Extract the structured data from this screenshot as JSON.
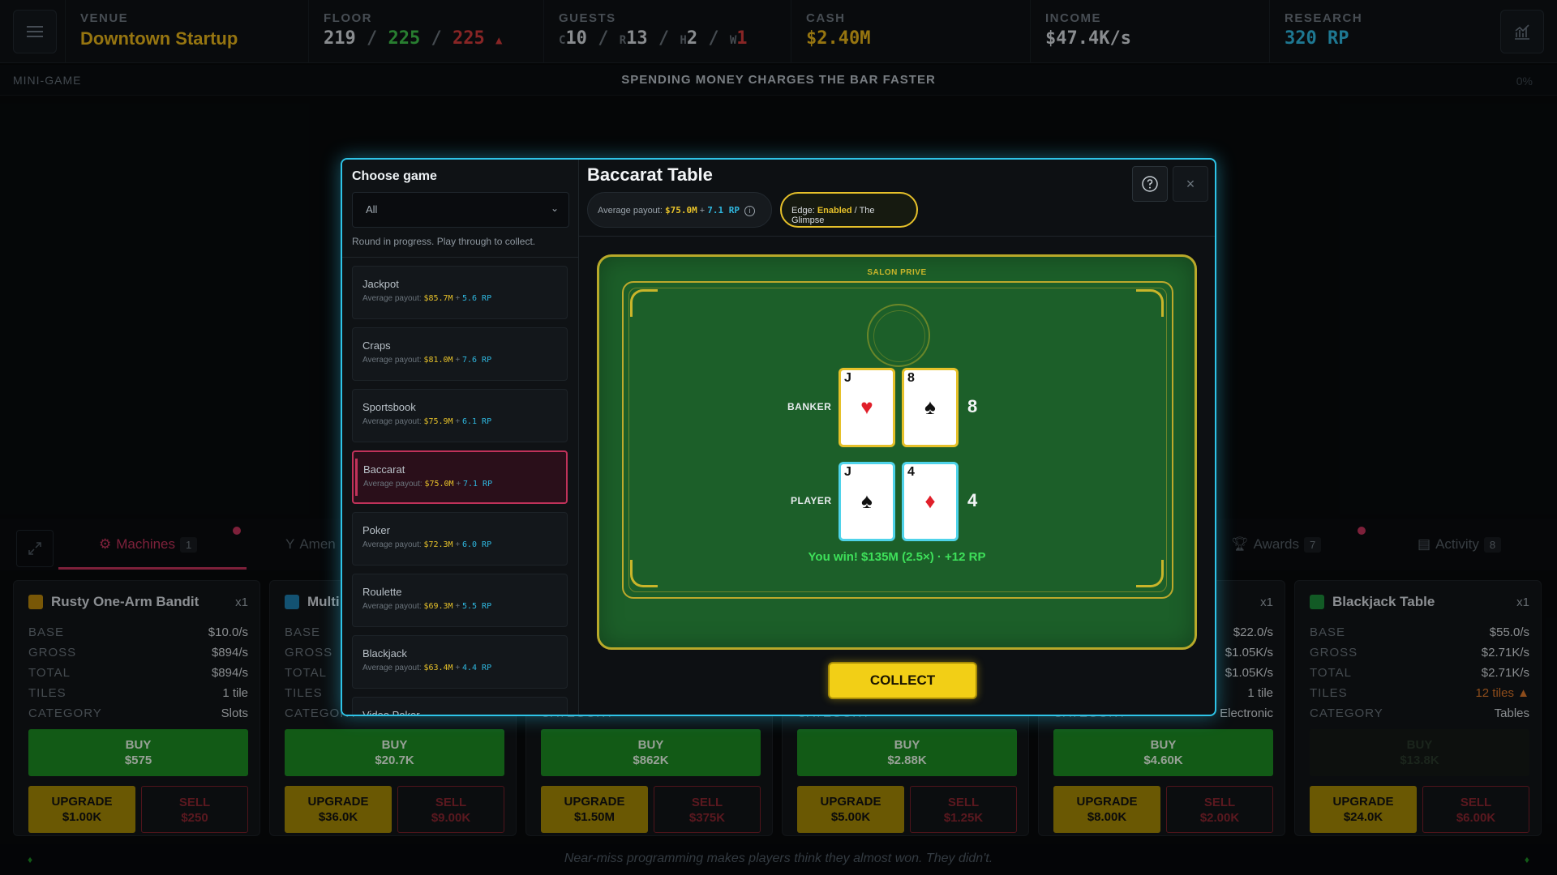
{
  "topbar": {
    "venue": {
      "label": "VENUE",
      "value": "Downtown Startup"
    },
    "floor": {
      "label": "FLOOR",
      "used": "219",
      "sep1": "/",
      "green": "225",
      "sep2": "/",
      "red": "225",
      "arrow": "▲"
    },
    "guests": {
      "label": "GUESTS",
      "c_lbl": "C",
      "c": "10",
      "r_lbl": "R",
      "r": "13",
      "h_lbl": "H",
      "h": "2",
      "w_lbl": "W",
      "w": "1",
      "sep": "/"
    },
    "cash": {
      "label": "CASH",
      "value": "$2.40M"
    },
    "income": {
      "label": "INCOME",
      "value": "$47.4K/s"
    },
    "research": {
      "label": "RESEARCH",
      "value": "320 RP"
    }
  },
  "subbar": {
    "label": "MINI-GAME",
    "message": "SPENDING MONEY CHARGES THE BAR FASTER",
    "percent": "0%"
  },
  "tabs": [
    {
      "label": "Machines",
      "count": "1"
    },
    {
      "label": "Amen",
      "count": ""
    },
    {
      "label": "Awards",
      "count": "7"
    },
    {
      "label": "Activity",
      "count": "8"
    }
  ],
  "cards": [
    {
      "title": "Rusty One-Arm Bandit",
      "qty": "x1",
      "color": "#b8860b",
      "base": "$10.0/s",
      "gross": "$894/s",
      "total": "$894/s",
      "tiles": "1 tile",
      "category": "Slots",
      "buy": "BUY",
      "buy_price": "$575",
      "upgrade": "UPGRADE",
      "upgrade_price": "$1.00K",
      "sell": "SELL",
      "sell_price": "$250"
    },
    {
      "title": "Multi",
      "qty": "",
      "color": "#1e7fb0",
      "base": "",
      "gross": "",
      "total": "",
      "tiles": "",
      "category": "",
      "buy": "BUY",
      "buy_price": "$20.7K",
      "upgrade": "UPGRADE",
      "upgrade_price": "$36.0K",
      "sell": "SELL",
      "sell_price": "$9.00K"
    },
    {
      "title": "",
      "qty": "",
      "color": "",
      "base": "",
      "gross": "",
      "total": "",
      "tiles": "",
      "category": "",
      "buy": "BUY",
      "buy_price": "$862K",
      "upgrade": "UPGRADE",
      "upgrade_price": "$1.50M",
      "sell": "SELL",
      "sell_price": "$375K"
    },
    {
      "title": "",
      "qty": "",
      "color": "",
      "base": "",
      "gross": "",
      "total": "",
      "tiles": "",
      "category": "",
      "buy": "BUY",
      "buy_price": "$2.88K",
      "upgrade": "UPGRADE",
      "upgrade_price": "$5.00K",
      "sell": "SELL",
      "sell_price": "$1.25K"
    },
    {
      "title": "",
      "qty": "x1",
      "color": "",
      "base": "$22.0/s",
      "gross": "$1.05K/s",
      "total": "$1.05K/s",
      "tiles": "1 tile",
      "category": "Electronic",
      "buy": "BUY",
      "buy_price": "$4.60K",
      "upgrade": "UPGRADE",
      "upgrade_price": "$8.00K",
      "sell": "SELL",
      "sell_price": "$2.00K"
    },
    {
      "title": "Blackjack Table",
      "qty": "x1",
      "color": "#1c8a3a",
      "base": "$55.0/s",
      "gross": "$2.71K/s",
      "total": "$2.71K/s",
      "tiles": "12 tiles ▲",
      "category": "Tables",
      "buy": "BUY",
      "buy_price": "$13.8K",
      "upgrade": "UPGRADE",
      "upgrade_price": "$24.0K",
      "sell": "SELL",
      "sell_price": "$6.00K"
    }
  ],
  "card_labels": {
    "base": "BASE",
    "gross": "GROSS",
    "total": "TOTAL",
    "tiles": "TILES",
    "category": "CATEGORY"
  },
  "footer": {
    "quote": "Near-miss programming makes players think they almost won. They didn't."
  },
  "modal": {
    "choose_title": "Choose game",
    "filter_value": "All",
    "progress_note": "Round in progress. Play through to collect.",
    "payout_prefix": "Average payout:",
    "games": [
      {
        "name": "Jackpot",
        "money": "$85.7M",
        "rp": "5.6 RP"
      },
      {
        "name": "Craps",
        "money": "$81.0M",
        "rp": "7.6 RP"
      },
      {
        "name": "Sportsbook",
        "money": "$75.9M",
        "rp": "6.1 RP"
      },
      {
        "name": "Baccarat",
        "money": "$75.0M",
        "rp": "7.1 RP"
      },
      {
        "name": "Poker",
        "money": "$72.3M",
        "rp": "6.0 RP"
      },
      {
        "name": "Roulette",
        "money": "$69.3M",
        "rp": "5.5 RP"
      },
      {
        "name": "Blackjack",
        "money": "$63.4M",
        "rp": "4.4 RP"
      },
      {
        "name": "Video Poker",
        "money": "",
        "rp": ""
      }
    ],
    "selected_game": "Baccarat",
    "title": "Baccarat Table",
    "payout": {
      "label": "Average payout:",
      "money": "$75.0M",
      "plus": "+",
      "rp": "7.1 RP"
    },
    "edge": {
      "label": "Edge:",
      "status": "Enabled",
      "rest": "/ The Glimpse"
    },
    "close": "×",
    "table": {
      "salon": "SALON PRIVE",
      "banker_label": "BANKER",
      "player_label": "PLAYER",
      "banker_cards": [
        {
          "rank": "J",
          "suit": "♥",
          "color": "red"
        },
        {
          "rank": "8",
          "suit": "♠",
          "color": "black"
        }
      ],
      "player_cards": [
        {
          "rank": "J",
          "suit": "♠",
          "color": "black"
        },
        {
          "rank": "4",
          "suit": "♦",
          "color": "red"
        }
      ],
      "banker_score": "8",
      "player_score": "4",
      "result": "You win!  $135M (2.5×)  ·  +12 RP"
    },
    "collect": "COLLECT"
  }
}
